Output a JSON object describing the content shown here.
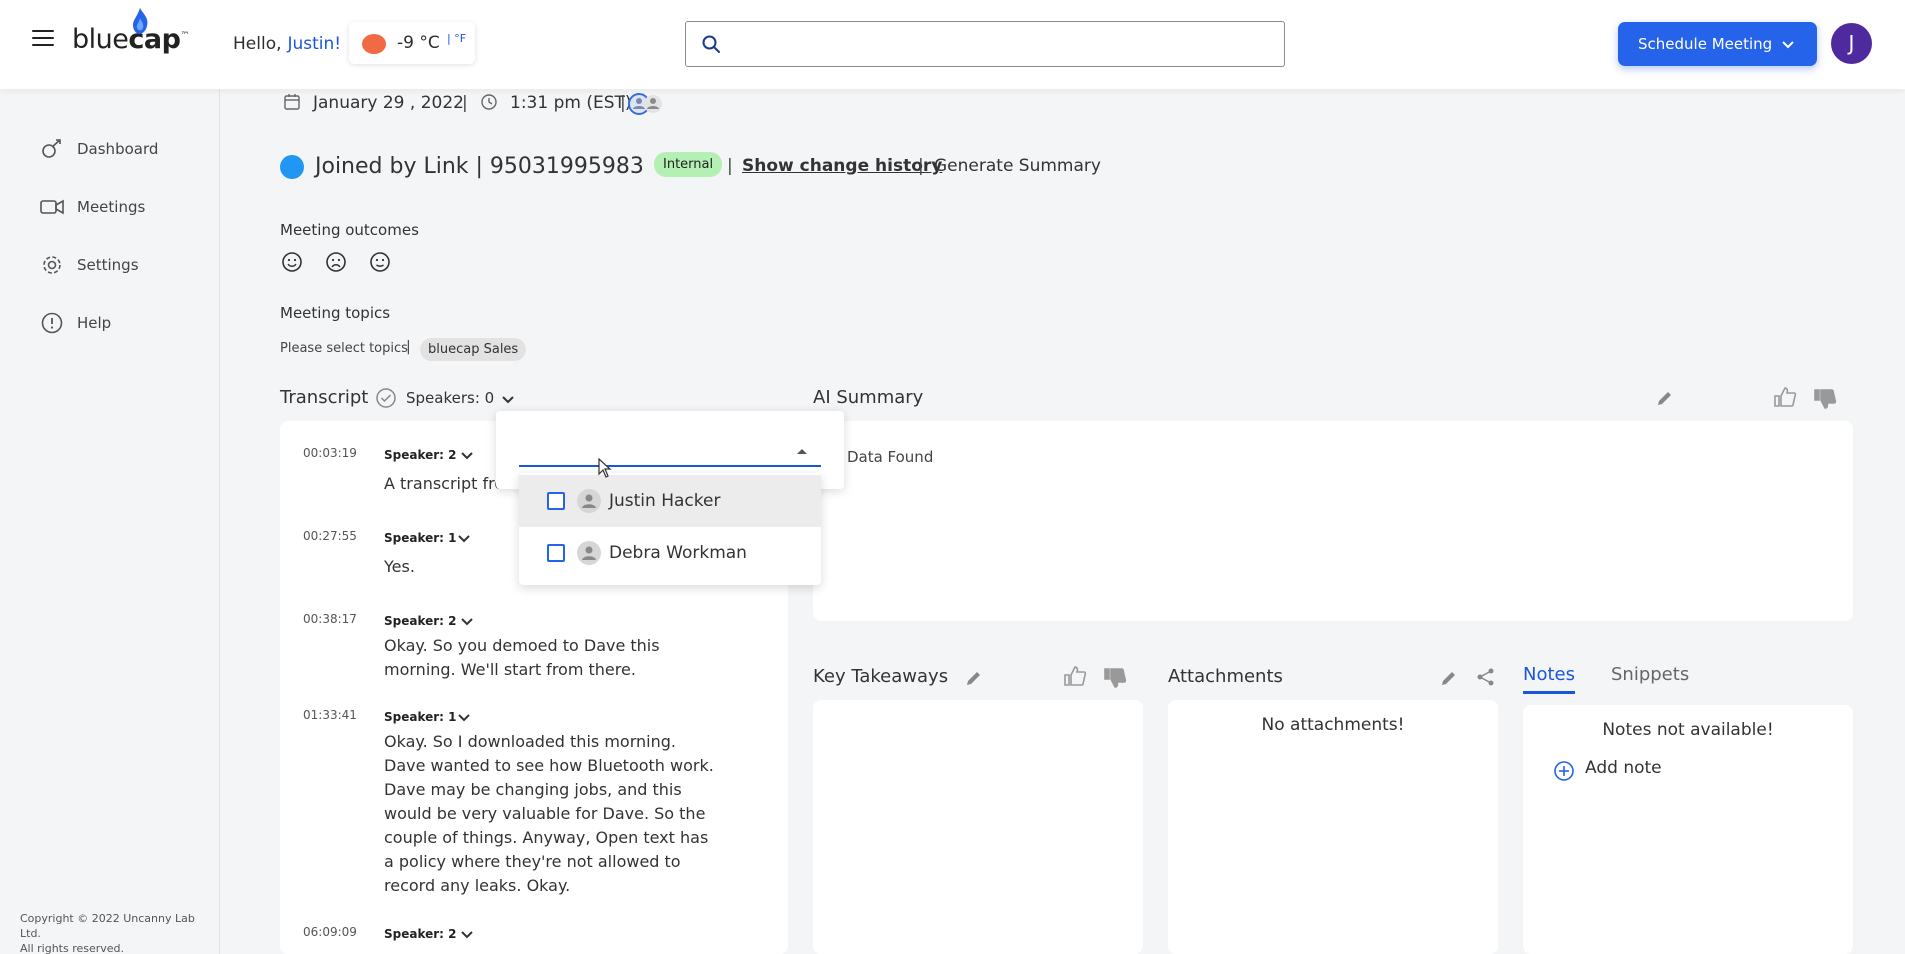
{
  "header": {
    "logo_text_light": "blue",
    "logo_text_bold": "cap",
    "logo_tm": "™",
    "greeting": "Hello,",
    "user_first_name": "Justin!",
    "weather_temp": "-9 °C",
    "weather_alt_unit": "| °F",
    "search_placeholder": "",
    "schedule_button": "Schedule Meeting",
    "avatar_initial": "J"
  },
  "sidebar": {
    "items": [
      {
        "label": "Dashboard",
        "icon": "dashboard-icon"
      },
      {
        "label": "Meetings",
        "icon": "video-camera-icon"
      },
      {
        "label": "Settings",
        "icon": "gear-icon"
      },
      {
        "label": "Help",
        "icon": "info-icon"
      }
    ],
    "copyright_line1": "Copyright © 2022 Uncanny Lab Ltd.",
    "copyright_line2": "All rights reserved."
  },
  "meeting": {
    "date": "January 29 , 2022",
    "time": "1:31 pm (EST)",
    "joined_text": "Joined by Link | 95031995983",
    "badge": "Internal",
    "show_history": "Show change history",
    "generate_summary": "Generate Summary",
    "outcomes_label": "Meeting outcomes",
    "outcome_faces": [
      "smile-face-icon",
      "sad-face-icon",
      "neutral-face-icon"
    ],
    "topics_label": "Meeting topics",
    "topics_hint": "Please select topics",
    "topic_chip": "bluecap Sales"
  },
  "transcript": {
    "title": "Transcript",
    "speakers_label": "Speakers: 0",
    "entries": [
      {
        "time": "00:03:19",
        "speaker": "Speaker: 2",
        "lines": [
          "A transcript fro"
        ]
      },
      {
        "time": "00:27:55",
        "speaker": "Speaker: 1",
        "lines": [
          "Yes."
        ]
      },
      {
        "time": "00:38:17",
        "speaker": "Speaker: 2",
        "lines": [
          "Okay. So you demoed to Dave this",
          "morning. We'll start from there."
        ]
      },
      {
        "time": "01:33:41",
        "speaker": "Speaker: 1",
        "lines": [
          "Okay. So I downloaded this morning.",
          "Dave wanted to see how Bluetooth work.",
          "Dave may be changing jobs, and this",
          "would be very valuable for Dave. So the",
          "couple of things. Anyway, Open text has",
          "a policy where they're not allowed to",
          "record any leaks. Okay."
        ]
      },
      {
        "time": "06:09:09",
        "speaker": "Speaker: 2",
        "lines": []
      }
    ]
  },
  "speaker_dropdown": {
    "options": [
      {
        "name": "Justin Hacker",
        "checked": false
      },
      {
        "name": "Debra Workman",
        "checked": false
      }
    ]
  },
  "ai_summary": {
    "title": "AI Summary",
    "empty": "o Data Found"
  },
  "key_takeaways": {
    "title": "Key Takeaways"
  },
  "attachments": {
    "title": "Attachments",
    "empty": "No attachments!"
  },
  "notes": {
    "tab_notes": "Notes",
    "tab_snippets": "Snippets",
    "empty": "Notes not available!",
    "add_note": "Add note"
  },
  "colors": {
    "accent": "#1a56db",
    "primary_button": "#2563eb",
    "avatar": "#4f2a9e",
    "internal_badge": "#b4f0b3",
    "weather_sun": "#f06a43"
  }
}
